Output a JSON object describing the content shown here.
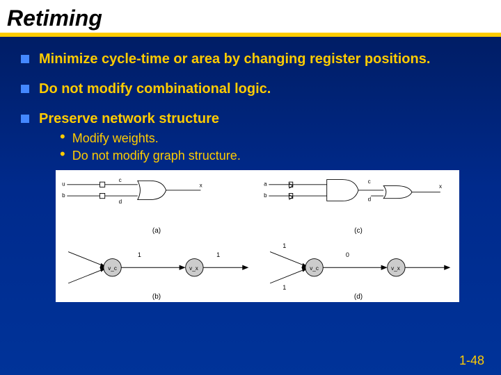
{
  "title": "Retiming",
  "bullets": [
    {
      "text": "Minimize cycle-time or area by changing register positions."
    },
    {
      "text": "Do not modify combinational logic."
    },
    {
      "text": "Preserve network structure",
      "subs": [
        "Modify weights.",
        "Do not modify graph structure."
      ]
    }
  ],
  "diagram": {
    "panels": [
      {
        "id": "a",
        "label": "(a)",
        "ports_in": [
          "u",
          "b"
        ],
        "mids": [
          "c",
          "d"
        ],
        "out": "x"
      },
      {
        "id": "c",
        "label": "(c)",
        "ports_in": [
          "a",
          "b"
        ],
        "mids": [
          "c",
          "d"
        ],
        "out": "x"
      },
      {
        "id": "b",
        "label": "(b)",
        "node_left": "v_c",
        "node_right": "v_x",
        "wl": "1",
        "wr": "1"
      },
      {
        "id": "d",
        "label": "(d)",
        "node_left": "v_c",
        "node_right": "v_x",
        "wl_top": "1",
        "wl_bot": "1",
        "wr": "0"
      }
    ]
  },
  "page_number": "1-48"
}
